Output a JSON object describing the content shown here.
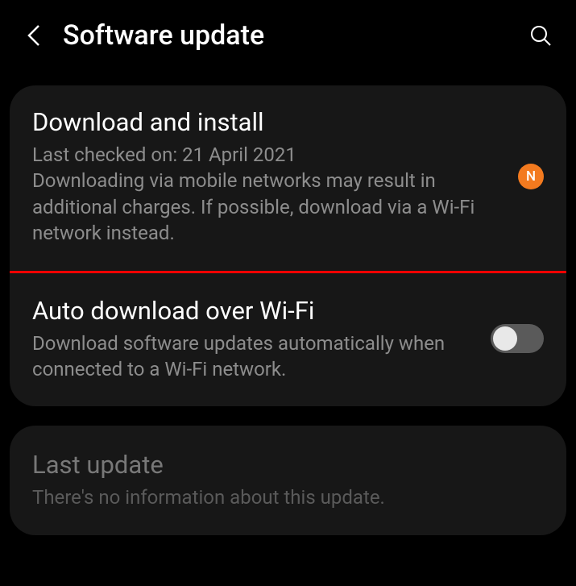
{
  "header": {
    "title": "Software update"
  },
  "card1": {
    "item1": {
      "title": "Download and install",
      "description": "Last checked on: 21 April 2021\nDownloading via mobile networks may result in additional charges. If possible, download via a Wi-Fi network instead.",
      "badge": "N"
    },
    "item2": {
      "title": "Auto download over Wi-Fi",
      "description": "Download software updates automatically when connected to a Wi-Fi network."
    }
  },
  "card2": {
    "item1": {
      "title": "Last update",
      "description": "There's no information about this update."
    }
  }
}
